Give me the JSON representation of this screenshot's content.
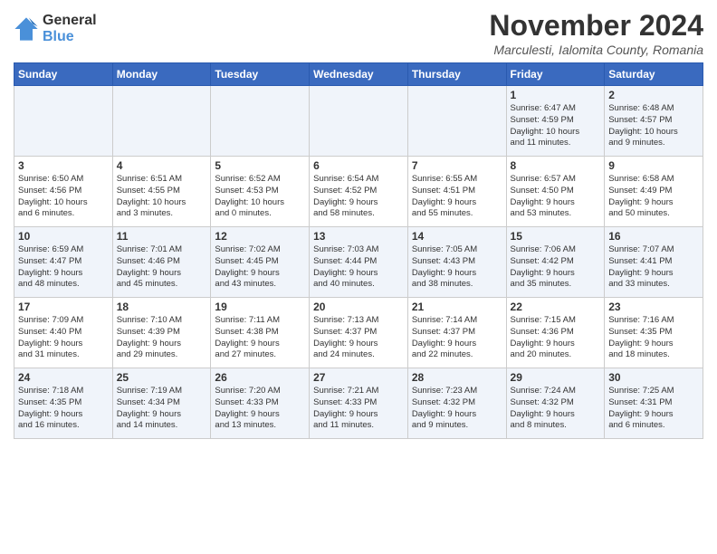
{
  "header": {
    "logo_line1": "General",
    "logo_line2": "Blue",
    "month_title": "November 2024",
    "location": "Marculesti, Ialomita County, Romania"
  },
  "weekdays": [
    "Sunday",
    "Monday",
    "Tuesday",
    "Wednesday",
    "Thursday",
    "Friday",
    "Saturday"
  ],
  "weeks": [
    [
      {
        "day": "",
        "info": ""
      },
      {
        "day": "",
        "info": ""
      },
      {
        "day": "",
        "info": ""
      },
      {
        "day": "",
        "info": ""
      },
      {
        "day": "",
        "info": ""
      },
      {
        "day": "1",
        "info": "Sunrise: 6:47 AM\nSunset: 4:59 PM\nDaylight: 10 hours\nand 11 minutes."
      },
      {
        "day": "2",
        "info": "Sunrise: 6:48 AM\nSunset: 4:57 PM\nDaylight: 10 hours\nand 9 minutes."
      }
    ],
    [
      {
        "day": "3",
        "info": "Sunrise: 6:50 AM\nSunset: 4:56 PM\nDaylight: 10 hours\nand 6 minutes."
      },
      {
        "day": "4",
        "info": "Sunrise: 6:51 AM\nSunset: 4:55 PM\nDaylight: 10 hours\nand 3 minutes."
      },
      {
        "day": "5",
        "info": "Sunrise: 6:52 AM\nSunset: 4:53 PM\nDaylight: 10 hours\nand 0 minutes."
      },
      {
        "day": "6",
        "info": "Sunrise: 6:54 AM\nSunset: 4:52 PM\nDaylight: 9 hours\nand 58 minutes."
      },
      {
        "day": "7",
        "info": "Sunrise: 6:55 AM\nSunset: 4:51 PM\nDaylight: 9 hours\nand 55 minutes."
      },
      {
        "day": "8",
        "info": "Sunrise: 6:57 AM\nSunset: 4:50 PM\nDaylight: 9 hours\nand 53 minutes."
      },
      {
        "day": "9",
        "info": "Sunrise: 6:58 AM\nSunset: 4:49 PM\nDaylight: 9 hours\nand 50 minutes."
      }
    ],
    [
      {
        "day": "10",
        "info": "Sunrise: 6:59 AM\nSunset: 4:47 PM\nDaylight: 9 hours\nand 48 minutes."
      },
      {
        "day": "11",
        "info": "Sunrise: 7:01 AM\nSunset: 4:46 PM\nDaylight: 9 hours\nand 45 minutes."
      },
      {
        "day": "12",
        "info": "Sunrise: 7:02 AM\nSunset: 4:45 PM\nDaylight: 9 hours\nand 43 minutes."
      },
      {
        "day": "13",
        "info": "Sunrise: 7:03 AM\nSunset: 4:44 PM\nDaylight: 9 hours\nand 40 minutes."
      },
      {
        "day": "14",
        "info": "Sunrise: 7:05 AM\nSunset: 4:43 PM\nDaylight: 9 hours\nand 38 minutes."
      },
      {
        "day": "15",
        "info": "Sunrise: 7:06 AM\nSunset: 4:42 PM\nDaylight: 9 hours\nand 35 minutes."
      },
      {
        "day": "16",
        "info": "Sunrise: 7:07 AM\nSunset: 4:41 PM\nDaylight: 9 hours\nand 33 minutes."
      }
    ],
    [
      {
        "day": "17",
        "info": "Sunrise: 7:09 AM\nSunset: 4:40 PM\nDaylight: 9 hours\nand 31 minutes."
      },
      {
        "day": "18",
        "info": "Sunrise: 7:10 AM\nSunset: 4:39 PM\nDaylight: 9 hours\nand 29 minutes."
      },
      {
        "day": "19",
        "info": "Sunrise: 7:11 AM\nSunset: 4:38 PM\nDaylight: 9 hours\nand 27 minutes."
      },
      {
        "day": "20",
        "info": "Sunrise: 7:13 AM\nSunset: 4:37 PM\nDaylight: 9 hours\nand 24 minutes."
      },
      {
        "day": "21",
        "info": "Sunrise: 7:14 AM\nSunset: 4:37 PM\nDaylight: 9 hours\nand 22 minutes."
      },
      {
        "day": "22",
        "info": "Sunrise: 7:15 AM\nSunset: 4:36 PM\nDaylight: 9 hours\nand 20 minutes."
      },
      {
        "day": "23",
        "info": "Sunrise: 7:16 AM\nSunset: 4:35 PM\nDaylight: 9 hours\nand 18 minutes."
      }
    ],
    [
      {
        "day": "24",
        "info": "Sunrise: 7:18 AM\nSunset: 4:35 PM\nDaylight: 9 hours\nand 16 minutes."
      },
      {
        "day": "25",
        "info": "Sunrise: 7:19 AM\nSunset: 4:34 PM\nDaylight: 9 hours\nand 14 minutes."
      },
      {
        "day": "26",
        "info": "Sunrise: 7:20 AM\nSunset: 4:33 PM\nDaylight: 9 hours\nand 13 minutes."
      },
      {
        "day": "27",
        "info": "Sunrise: 7:21 AM\nSunset: 4:33 PM\nDaylight: 9 hours\nand 11 minutes."
      },
      {
        "day": "28",
        "info": "Sunrise: 7:23 AM\nSunset: 4:32 PM\nDaylight: 9 hours\nand 9 minutes."
      },
      {
        "day": "29",
        "info": "Sunrise: 7:24 AM\nSunset: 4:32 PM\nDaylight: 9 hours\nand 8 minutes."
      },
      {
        "day": "30",
        "info": "Sunrise: 7:25 AM\nSunset: 4:31 PM\nDaylight: 9 hours\nand 6 minutes."
      }
    ]
  ]
}
